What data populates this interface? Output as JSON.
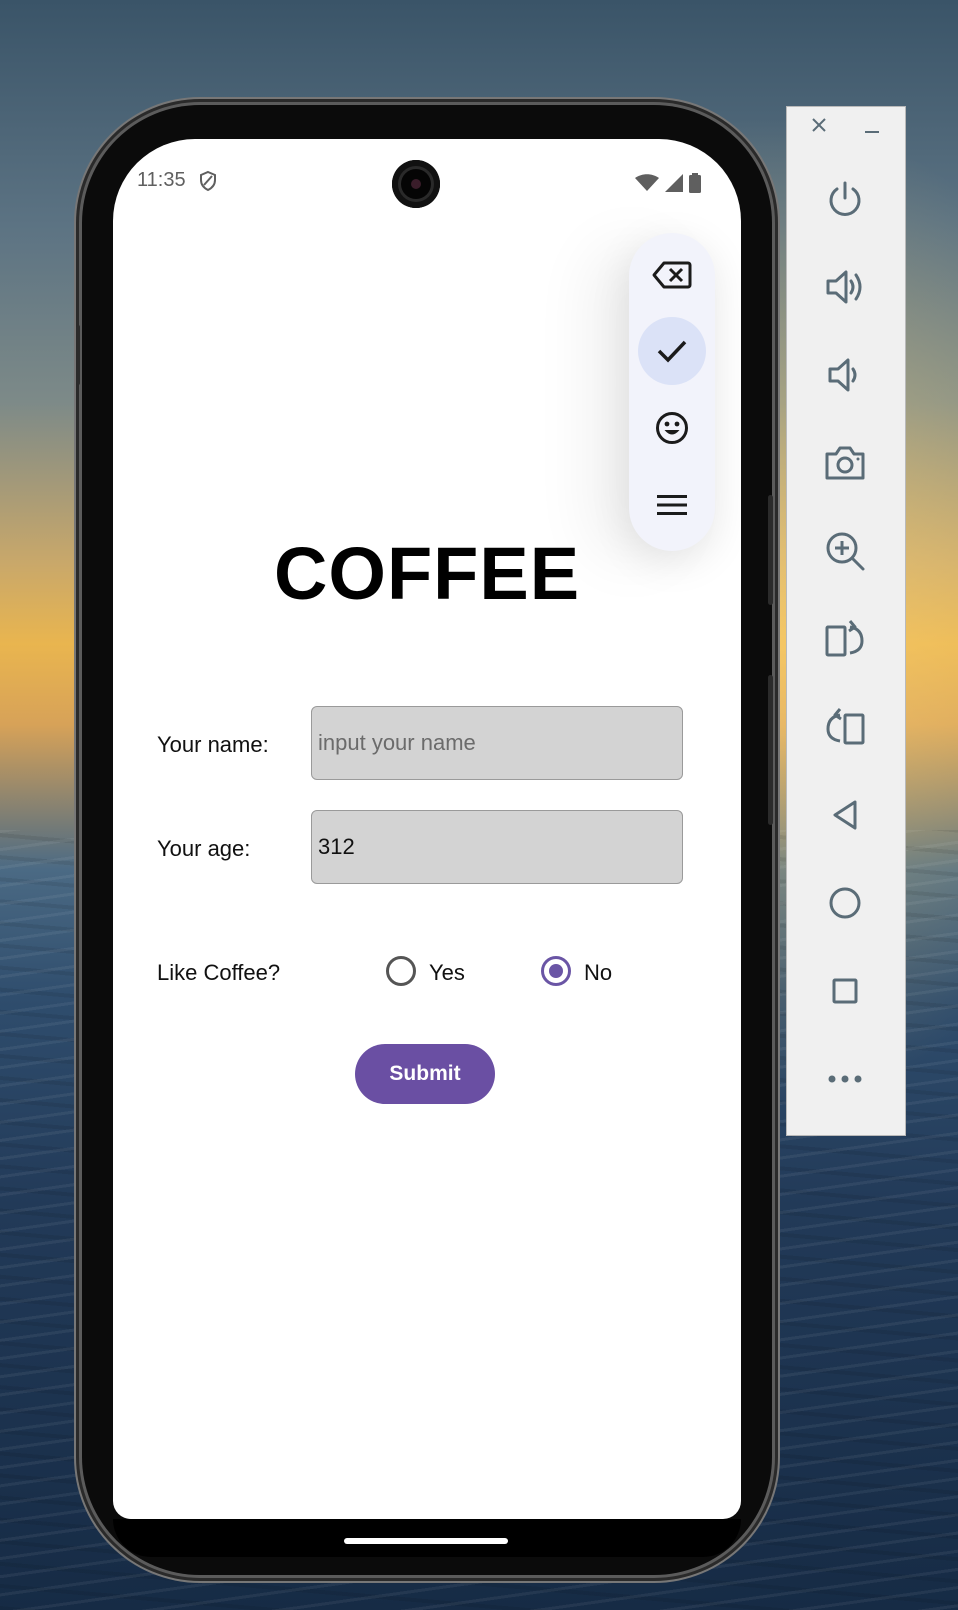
{
  "status_bar": {
    "time": "11:35",
    "icons": [
      "shield-icon",
      "wifi-icon",
      "signal-icon",
      "battery-icon"
    ]
  },
  "keyboard_toolbar": {
    "buttons": [
      "backspace-icon",
      "check-icon",
      "emoji-icon",
      "menu-icon"
    ],
    "active": "check-icon"
  },
  "app": {
    "title": "COFFEE",
    "name_label": "Your name:",
    "name_placeholder": "input your name",
    "name_value": "",
    "age_label": "Your age:",
    "age_value": "312",
    "like_label": "Like Coffee?",
    "options": [
      {
        "label": "Yes",
        "checked": false
      },
      {
        "label": "No",
        "checked": true
      }
    ],
    "submit_label": "Submit"
  },
  "emulator_panel": {
    "controls": [
      "close-icon",
      "minimize-icon",
      "power-icon",
      "volume-up-icon",
      "volume-down-icon",
      "camera-icon",
      "zoom-in-icon",
      "rotate-right-icon",
      "rotate-left-icon",
      "back-icon",
      "home-icon",
      "overview-icon",
      "more-icon"
    ]
  },
  "colors": {
    "accent": "#6a4fa3",
    "field_bg": "#d3d3d3",
    "panel_icon": "#5a6c77"
  }
}
